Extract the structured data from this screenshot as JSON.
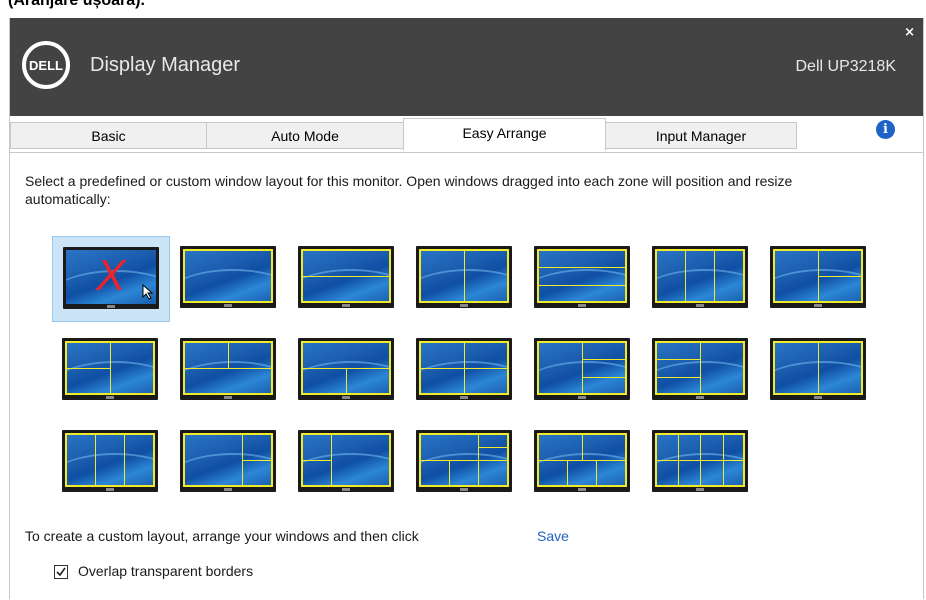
{
  "caption": "(Aranjare ușoară).",
  "window": {
    "app_title": "Display Manager",
    "monitor_name": "Dell UP3218K",
    "logo_text": "DELL",
    "close_label": "×"
  },
  "tabs": [
    {
      "label": "Basic"
    },
    {
      "label": "Auto Mode"
    },
    {
      "label": "Easy Arrange"
    },
    {
      "label": "Input Manager"
    }
  ],
  "active_tab": "Easy Arrange",
  "info_icon": "i",
  "description": "Select a predefined or custom window layout for this monitor.  Open windows dragged into each zone will position and resize automatically:",
  "layouts": {
    "count": 20,
    "selected_index": 0,
    "selected_marker": "X",
    "zone_color": "#f0ea2a",
    "x_color": "#e8252a"
  },
  "footer": {
    "custom_text": "To create a custom layout, arrange your windows and then click",
    "save_link": "Save",
    "overlap_label": "Overlap transparent borders",
    "overlap_checked": true
  },
  "colors": {
    "titlebar": "#434343",
    "link": "#1e63c6",
    "selection_bg": "#cce4f7"
  }
}
